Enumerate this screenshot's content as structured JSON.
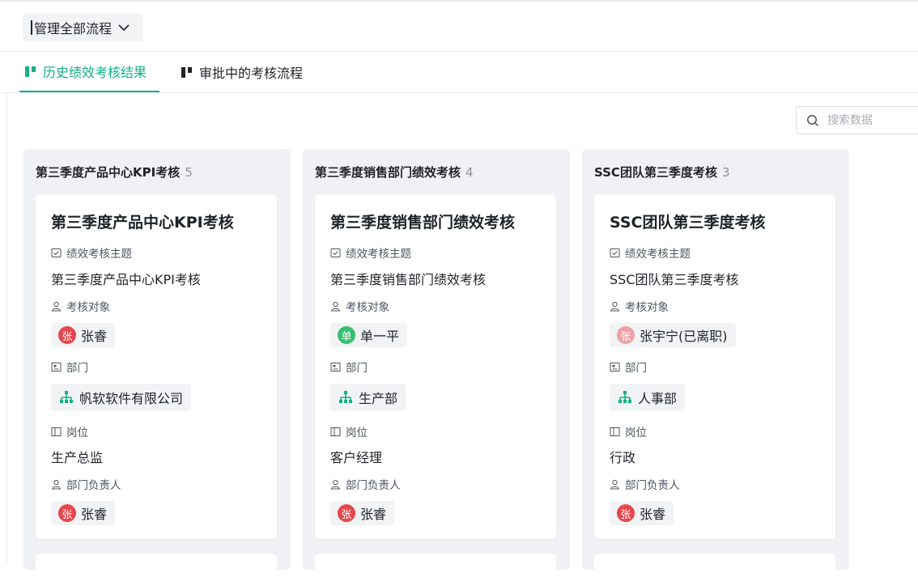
{
  "header": {
    "scope_label": "管理全部流程"
  },
  "tabs": [
    {
      "label": "历史绩效考核结果",
      "active": true
    },
    {
      "label": "审批中的考核流程",
      "active": false
    }
  ],
  "search": {
    "placeholder": "搜索数据"
  },
  "field_labels": {
    "theme": "绩效考核主题",
    "target": "考核对象",
    "dept": "部门",
    "position": "岗位",
    "leader": "部门负责人"
  },
  "colors": {
    "accent": "#14b085",
    "avatar_red": "#e5484d",
    "avatar_green": "#34c06f",
    "avatar_faded": "#f0a0a2"
  },
  "columns": [
    {
      "title": "第三季度产品中心KPI考核",
      "count": "5",
      "card": {
        "title": "第三季度产品中心KPI考核",
        "theme": "第三季度产品中心KPI考核",
        "target": {
          "avatar": "张",
          "name": "张睿",
          "avatar_color": "#e5484d"
        },
        "dept": "帆软软件有限公司",
        "position": "生产总监",
        "leader": {
          "avatar": "张",
          "name": "张睿",
          "avatar_color": "#e5484d"
        }
      }
    },
    {
      "title": "第三季度销售部门绩效考核",
      "count": "4",
      "card": {
        "title": "第三季度销售部门绩效考核",
        "theme": "第三季度销售部门绩效考核",
        "target": {
          "avatar": "单",
          "name": "单一平",
          "avatar_color": "#34c06f"
        },
        "dept": "生产部",
        "position": "客户经理",
        "leader": {
          "avatar": "张",
          "name": "张睿",
          "avatar_color": "#e5484d"
        }
      }
    },
    {
      "title": "SSC团队第三季度考核",
      "count": "3",
      "card": {
        "title": "SSC团队第三季度考核",
        "theme": "SSC团队第三季度考核",
        "target": {
          "avatar": "张",
          "name": "张宇宁(已离职)",
          "avatar_color": "#f0a0a2"
        },
        "dept": "人事部",
        "position": "行政",
        "leader": {
          "avatar": "张",
          "name": "张睿",
          "avatar_color": "#e5484d"
        }
      }
    }
  ]
}
